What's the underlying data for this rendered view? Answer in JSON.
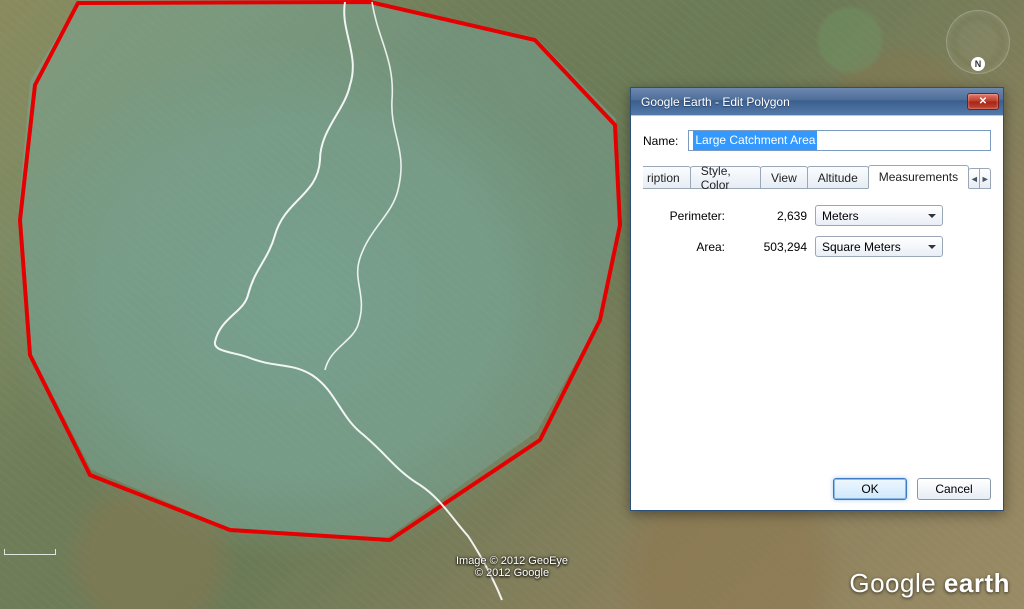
{
  "compass": {
    "n": "N"
  },
  "credits": {
    "line1": "Image © 2012 GeoEye",
    "line2": "© 2012 Google"
  },
  "logo": {
    "brand": "Google",
    "product": "earth"
  },
  "dialog": {
    "title": "Google Earth - Edit Polygon",
    "name_label": "Name:",
    "name_value": "Large Catchment Area",
    "tabs": {
      "description_cut": "ription",
      "style": "Style, Color",
      "view": "View",
      "altitude": "Altitude",
      "measurements": "Measurements"
    },
    "measurements": {
      "perimeter_label": "Perimeter:",
      "perimeter_value": "2,639",
      "perimeter_unit": "Meters",
      "area_label": "Area:",
      "area_value": "503,294",
      "area_unit": "Square Meters"
    },
    "buttons": {
      "ok": "OK",
      "cancel": "Cancel"
    },
    "scroll": {
      "left": "◄",
      "right": "►"
    },
    "close": "✕"
  }
}
